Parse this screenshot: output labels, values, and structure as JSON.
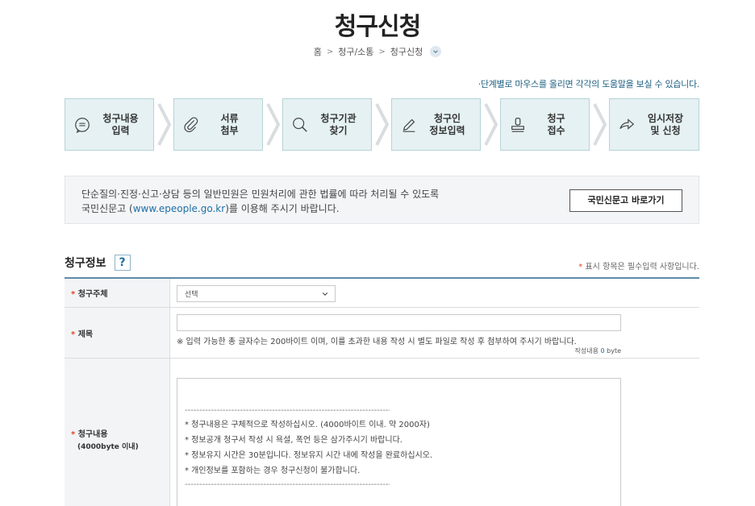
{
  "page": {
    "title": "청구신청"
  },
  "breadcrumb": {
    "home": "홈",
    "level1": "청구/소통",
    "level2": "청구신청",
    "separator": ">"
  },
  "step_hint": "·단계별로 마우스를 올리면 각각의 도움말을 보실 수 있습니다.",
  "steps": [
    {
      "label": "청구내용\n입력",
      "icon": "speech-bubble-icon"
    },
    {
      "label": "서류\n첨부",
      "icon": "paperclip-icon"
    },
    {
      "label": "청구기관\n찾기",
      "icon": "magnifier-icon"
    },
    {
      "label": "청구인\n정보입력",
      "icon": "pencil-icon"
    },
    {
      "label": "청구\n접수",
      "icon": "stamp-icon"
    },
    {
      "label": "임시저장\n및 신청",
      "icon": "send-arrow-icon"
    }
  ],
  "notice": {
    "line1": "단순질의·진정·신고·상담 등의 일반민원은 민원처리에 관한 법률에 따라 처리될 수 있도록",
    "line2_prefix": "국민신문고 (",
    "url": "www.epeople.go.kr",
    "line2_suffix": ")를 이용해 주시기 바랍니다.",
    "button": "국민신문고 바로가기"
  },
  "section": {
    "title": "청구정보",
    "help_label": "?",
    "required_star": "*",
    "required_note": "표시 항목은 필수입력 사항입니다."
  },
  "form": {
    "requester_type": {
      "label": "청구주체",
      "star": "*",
      "selected": "선택"
    },
    "subject": {
      "label": "제목",
      "star": "*",
      "value": "",
      "description": "※ 입력 가능한 총 글자수는 200바이트 이며, 이를 초과한 내용 작성 시 별도 파일로 작성 후 첨부하여 주시기 바랍니다.",
      "byte_prefix": "작성내용",
      "byte_count": "0",
      "byte_unit": "byte"
    },
    "content": {
      "label": "청구내용",
      "star": "*",
      "sublabel": "(4000byte 이내)",
      "dash_line": "--------------------------------------------------------------------------------------------",
      "lines": [
        "* 청구내용은 구체적으로 작성하십시오. (4000바이트 이내. 약 2000자)",
        "* 정보공개 청구서 작성 시 욕설, 폭언 등은 삼가주시기 바랍니다.",
        "* 정보유지 시간은 30분입니다. 정보유지 시간 내에 작성을 완료하십시오.",
        "* 개인정보를 포함하는 경우 청구신청이 불가합니다."
      ]
    }
  },
  "colors": {
    "accent": "#1d6fa6",
    "step_bg": "#e5f1f3",
    "required_star": "#e0462c",
    "table_border": "#5f8ba8"
  }
}
